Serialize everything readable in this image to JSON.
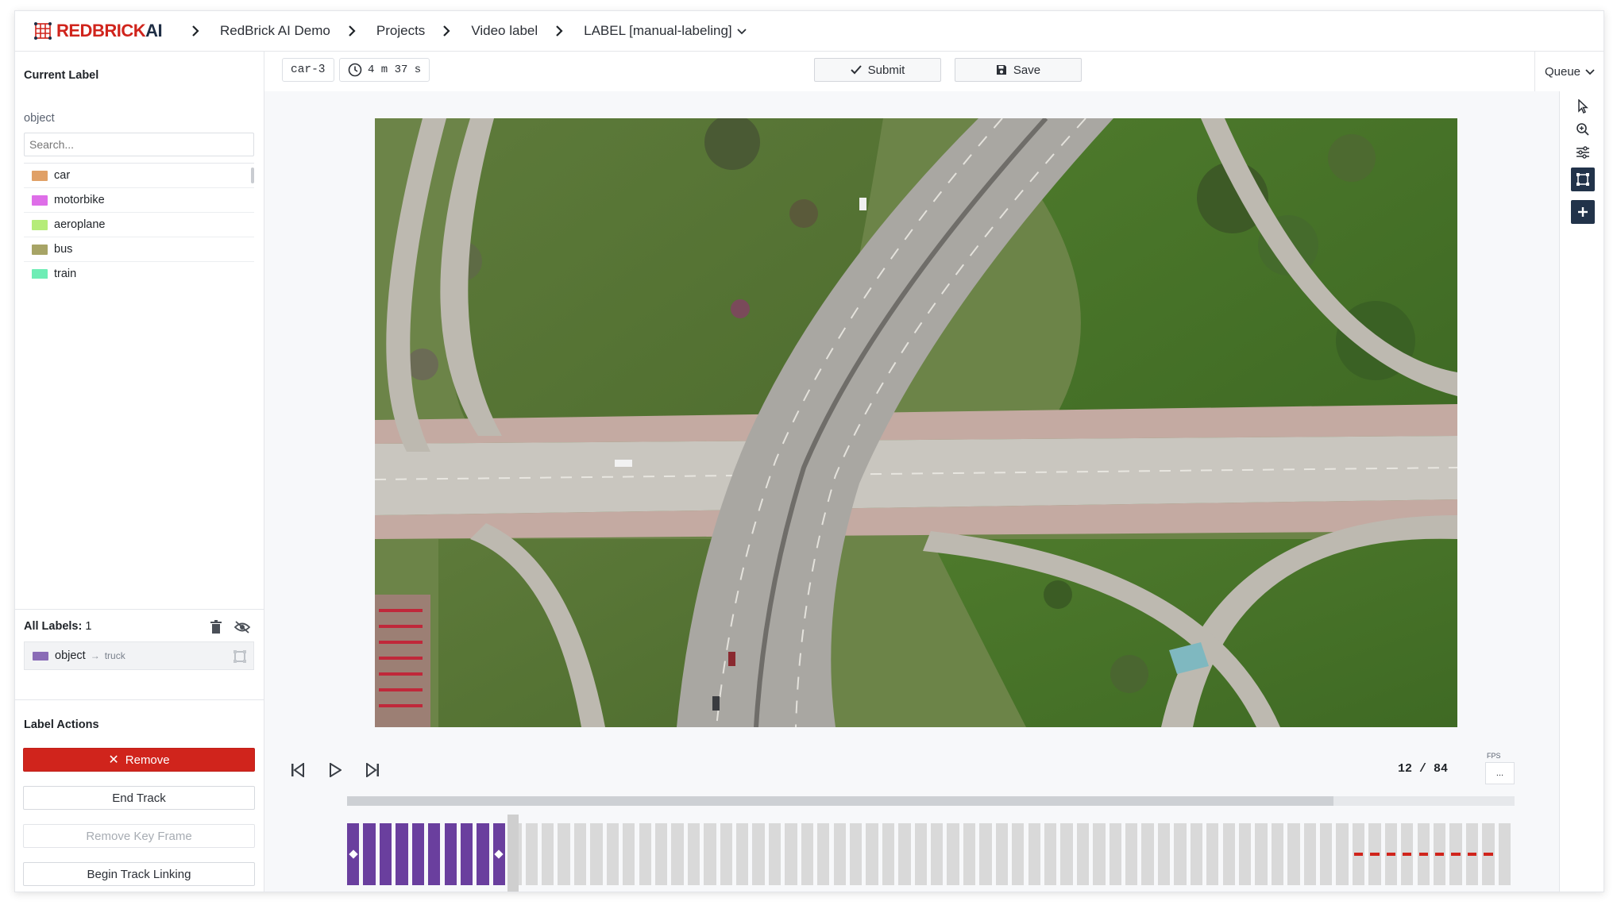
{
  "brand": {
    "red": "REDBRICK",
    "dark": "AI"
  },
  "breadcrumbs": [
    {
      "label": "RedBrick AI Demo"
    },
    {
      "label": "Projects"
    },
    {
      "label": "Video label"
    },
    {
      "label": "LABEL [manual-labeling]"
    }
  ],
  "sidebar": {
    "current_label_title": "Current Label",
    "class_name": "object",
    "search_placeholder": "Search...",
    "classes": [
      {
        "name": "car",
        "color": "#e0a066"
      },
      {
        "name": "motorbike",
        "color": "#de6ee8"
      },
      {
        "name": "aeroplane",
        "color": "#b5ec79"
      },
      {
        "name": "bus",
        "color": "#a7a466"
      },
      {
        "name": "train",
        "color": "#6eedb5"
      },
      {
        "name": "truck",
        "color": "#8a6cb6",
        "selected": true
      }
    ],
    "all_labels_title": "All Labels:",
    "all_labels_count": "1",
    "labels": [
      {
        "name": "object",
        "sub": "truck",
        "color": "#8a6cb6"
      }
    ],
    "label_actions_title": "Label Actions",
    "actions": {
      "remove": "Remove",
      "end_track": "End Track",
      "remove_key_frame": "Remove Key Frame",
      "begin_track_linking": "Begin Track Linking"
    }
  },
  "toolbar": {
    "task_name": "car-3",
    "timer": "4 m 37 s",
    "submit": "Submit",
    "save": "Save",
    "queue": "Queue"
  },
  "player": {
    "current_frame": 12,
    "total_frames": 84,
    "counter_text": "12 / 84",
    "fps_label": "FPS",
    "fps_value": "...",
    "progress_fraction": 0.845,
    "labeled_frames": 11
  },
  "colors": {
    "brand_red": "#d0241c",
    "brand_dark": "#1e2d44",
    "label_purple": "#6a3f9e",
    "keyframe_red": "#d0241c"
  },
  "icons": {
    "tools": [
      "pointer-icon",
      "zoom-icon",
      "sliders-icon",
      "bounding-box-icon",
      "plus-icon"
    ],
    "player": [
      "skip-back-icon",
      "play-icon",
      "skip-forward-icon"
    ]
  }
}
